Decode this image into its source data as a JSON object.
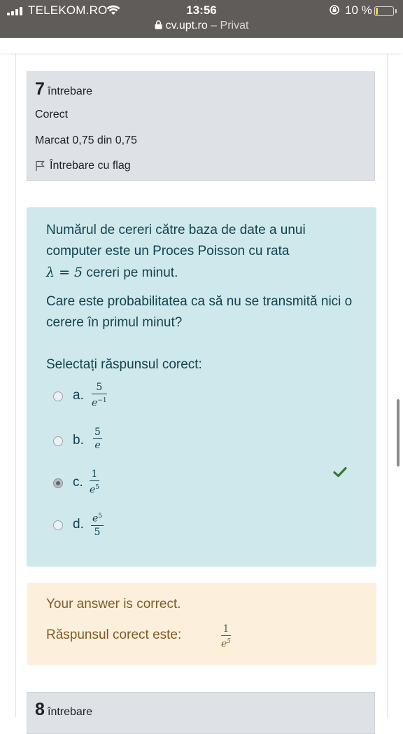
{
  "status_bar": {
    "carrier": "TELEKOM.RO",
    "time": "13:56",
    "battery_percent": "10 %",
    "battery_level": 0.1,
    "url_host": "cv.upt.ro",
    "url_suffix": " – Privat"
  },
  "question7": {
    "number": "7",
    "word": "întrebare",
    "state": "Corect",
    "grade": "Marcat 0,75 din 0,75",
    "flag_label": "Întrebare cu flag",
    "text_line1": "Numărul de cereri către baza de date a unui computer este un Proces Poisson cu rata",
    "lambda_expr": "λ = 5",
    "text_line1_suffix": " cereri pe minut.",
    "text_line2": "Care este probabilitatea ca să nu se transmită nici o cerere în primul minut?",
    "prompt": "Selectați răspunsul corect:",
    "options": [
      {
        "letter": "a.",
        "num": "5",
        "den": "e",
        "den_sup": "−1",
        "selected": false
      },
      {
        "letter": "b.",
        "num": "5",
        "den": "e",
        "den_sup": "",
        "selected": false
      },
      {
        "letter": "c.",
        "num": "1",
        "den": "e",
        "den_sup": "5",
        "selected": true
      },
      {
        "letter": "d.",
        "num": "e",
        "num_sup": "5",
        "den": "5",
        "den_sup": "",
        "selected": false
      }
    ],
    "correct_icon": "check-icon",
    "feedback_line1": "Your answer is correct.",
    "feedback_line2": "Răspunsul corect este:",
    "feedback_num": "1",
    "feedback_den": "e",
    "feedback_den_sup": "5"
  },
  "question8": {
    "number": "8",
    "word": "întrebare"
  },
  "colors": {
    "formulation_bg": "#cfe8ec",
    "feedback_bg": "#fcefdc",
    "info_bg": "#dee2e6",
    "correct_green": "#357a32"
  }
}
